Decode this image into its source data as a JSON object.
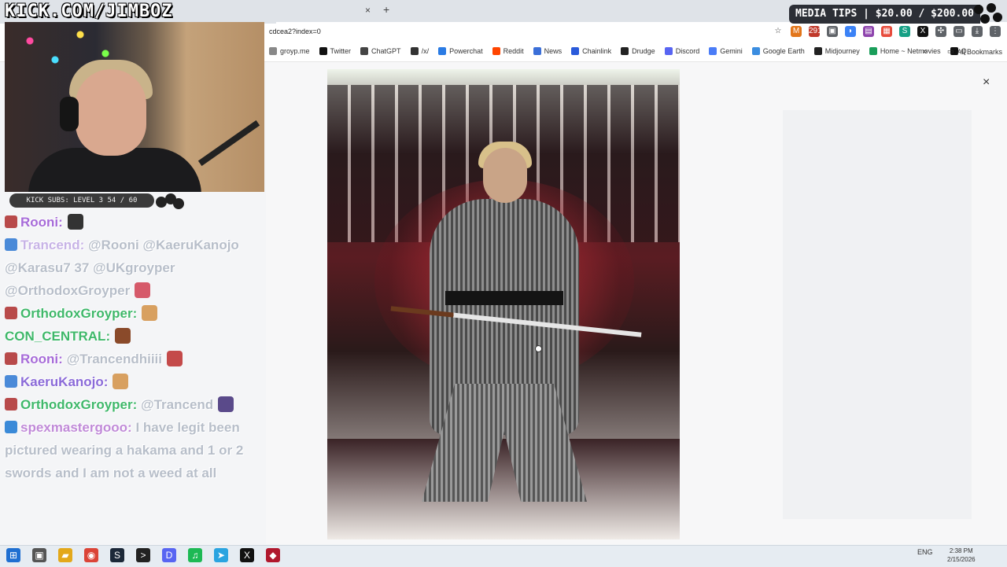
{
  "browser": {
    "url_fragment": "cdcea2?index=0",
    "tab_close": "×",
    "tab_new": "+",
    "bookmarks": [
      {
        "label": "groyp.me",
        "icon": "link-icon",
        "color": "#888888"
      },
      {
        "label": "Twitter",
        "icon": "x-icon",
        "color": "#111111"
      },
      {
        "label": "ChatGPT",
        "icon": "chatgpt-icon",
        "color": "#444444"
      },
      {
        "label": "/x/",
        "icon": "grid-icon",
        "color": "#333333"
      },
      {
        "label": "Powerchat",
        "icon": "powerchat-icon",
        "color": "#2a7be4"
      },
      {
        "label": "Reddit",
        "icon": "reddit-icon",
        "color": "#ff4500"
      },
      {
        "label": "News",
        "icon": "news-icon",
        "color": "#3b6fd8"
      },
      {
        "label": "Chainlink",
        "icon": "chainlink-icon",
        "color": "#2a5ada"
      },
      {
        "label": "Drudge",
        "icon": "drudge-icon",
        "color": "#222222"
      },
      {
        "label": "Discord",
        "icon": "discord-icon",
        "color": "#5865f2"
      },
      {
        "label": "Gemini",
        "icon": "gemini-icon",
        "color": "#4a7cf7"
      },
      {
        "label": "Google Earth",
        "icon": "earth-icon",
        "color": "#3b8de0"
      },
      {
        "label": "Midjourney",
        "icon": "midjourney-icon",
        "color": "#222222"
      },
      {
        "label": "Home ~ Netmovies",
        "icon": "netmovies-icon",
        "color": "#1a9e5a"
      },
      {
        "label": "Q",
        "icon": "q-icon",
        "color": "#111111"
      }
    ],
    "overflow": "»",
    "all_bookmarks": "All Bookmarks",
    "extensions": [
      {
        "icon": "star-icon",
        "glyph": "☆",
        "color": "#ffffff"
      },
      {
        "icon": "metamask-icon",
        "glyph": "M",
        "color": "#e2761b"
      },
      {
        "icon": "calendar-icon",
        "glyph": "291",
        "color": "#c0392b"
      },
      {
        "icon": "ext-icon",
        "glyph": "▣",
        "color": "#5f6368"
      },
      {
        "icon": "ext-icon",
        "glyph": "◗",
        "color": "#3b82f6"
      },
      {
        "icon": "ext-icon",
        "glyph": "▤",
        "color": "#8e44ad"
      },
      {
        "icon": "ext-icon",
        "glyph": "▦",
        "color": "#e74c3c"
      },
      {
        "icon": "ext-icon",
        "glyph": "S",
        "color": "#16a085"
      },
      {
        "icon": "x-ext-icon",
        "glyph": "X",
        "color": "#111111"
      },
      {
        "icon": "puzzle-icon",
        "glyph": "✣",
        "color": "#5f6368"
      },
      {
        "icon": "sidepanel-icon",
        "glyph": "▭",
        "color": "#5f6368"
      },
      {
        "icon": "download-icon",
        "glyph": "⤓",
        "color": "#5f6368"
      },
      {
        "icon": "menu-icon",
        "glyph": "⋮",
        "color": "#5f6368"
      }
    ]
  },
  "overlay": {
    "channel": "KICK.COM/JIMBOZ",
    "media_tips": "MEDIA TIPS | $20.00 / $200.00",
    "kick_subs": "KICK SUBS: LEVEL 3 54 / 60"
  },
  "chat": [
    {
      "user": "Rooni:",
      "color": "#a66bd8",
      "badge": "#b84a4a",
      "message": "",
      "emote": "#333333"
    },
    {
      "user": "Trancend:",
      "color": "#c7b3e6",
      "badge": "#4a8ad8",
      "message": "@Rooni @KaeruKanojo @Karasu7 37 @UKgroyper @OrthodoxGroyper",
      "emote": "#d65a6a"
    },
    {
      "user": "OrthodoxGroyper:",
      "color": "#3fb86a",
      "badge": "#b84a4a",
      "message": "",
      "emote": "#d8a060"
    },
    {
      "user": "CON_CENTRAL:",
      "color": "#3fb86a",
      "badge": "",
      "message": "",
      "emote": "#8a4a2a"
    },
    {
      "user": "Rooni:",
      "color": "#a66bd8",
      "badge": "#b84a4a",
      "message": "@Trancendhiiii",
      "emote": "#c44a4a"
    },
    {
      "user": "KaeruKanojo:",
      "color": "#8a6ad8",
      "badge": "#4a8ad8",
      "message": "",
      "emote": "#d8a060"
    },
    {
      "user": "OrthodoxGroyper:",
      "color": "#3fb86a",
      "badge": "#b84a4a",
      "message": "@Trancend",
      "emote": "#5a4a8a"
    },
    {
      "user": "spexmastergooo:",
      "color": "#c08ad8",
      "badge": "#3a8ad8",
      "message": "I have legit been pictured wearing a hakama and 1 or 2 swords and I am not a weed at all",
      "emote": ""
    }
  ],
  "viewer": {
    "close": "×"
  },
  "taskbar": {
    "icons": [
      {
        "icon": "windows-start-icon",
        "glyph": "⊞",
        "color": "#1f6fd1"
      },
      {
        "icon": "task-view-icon",
        "glyph": "▣",
        "color": "#555555"
      },
      {
        "icon": "file-explorer-icon",
        "glyph": "▰",
        "color": "#e3a81a"
      },
      {
        "icon": "chrome-icon",
        "glyph": "◉",
        "color": "#db4437"
      },
      {
        "icon": "steam-icon",
        "glyph": "S",
        "color": "#1b2838"
      },
      {
        "icon": "terminal-icon",
        "glyph": ">",
        "color": "#222222"
      },
      {
        "icon": "discord-icon",
        "glyph": "D",
        "color": "#5865f2"
      },
      {
        "icon": "spotify-icon",
        "glyph": "♫",
        "color": "#1db954"
      },
      {
        "icon": "telegram-icon",
        "glyph": "➤",
        "color": "#2aa4e0"
      },
      {
        "icon": "x-icon",
        "glyph": "X",
        "color": "#111111"
      },
      {
        "icon": "capcut-icon",
        "glyph": "◆",
        "color": "#b0182d"
      }
    ],
    "language": "ENG",
    "time": "2:38 PM",
    "date": "2/15/2026"
  }
}
